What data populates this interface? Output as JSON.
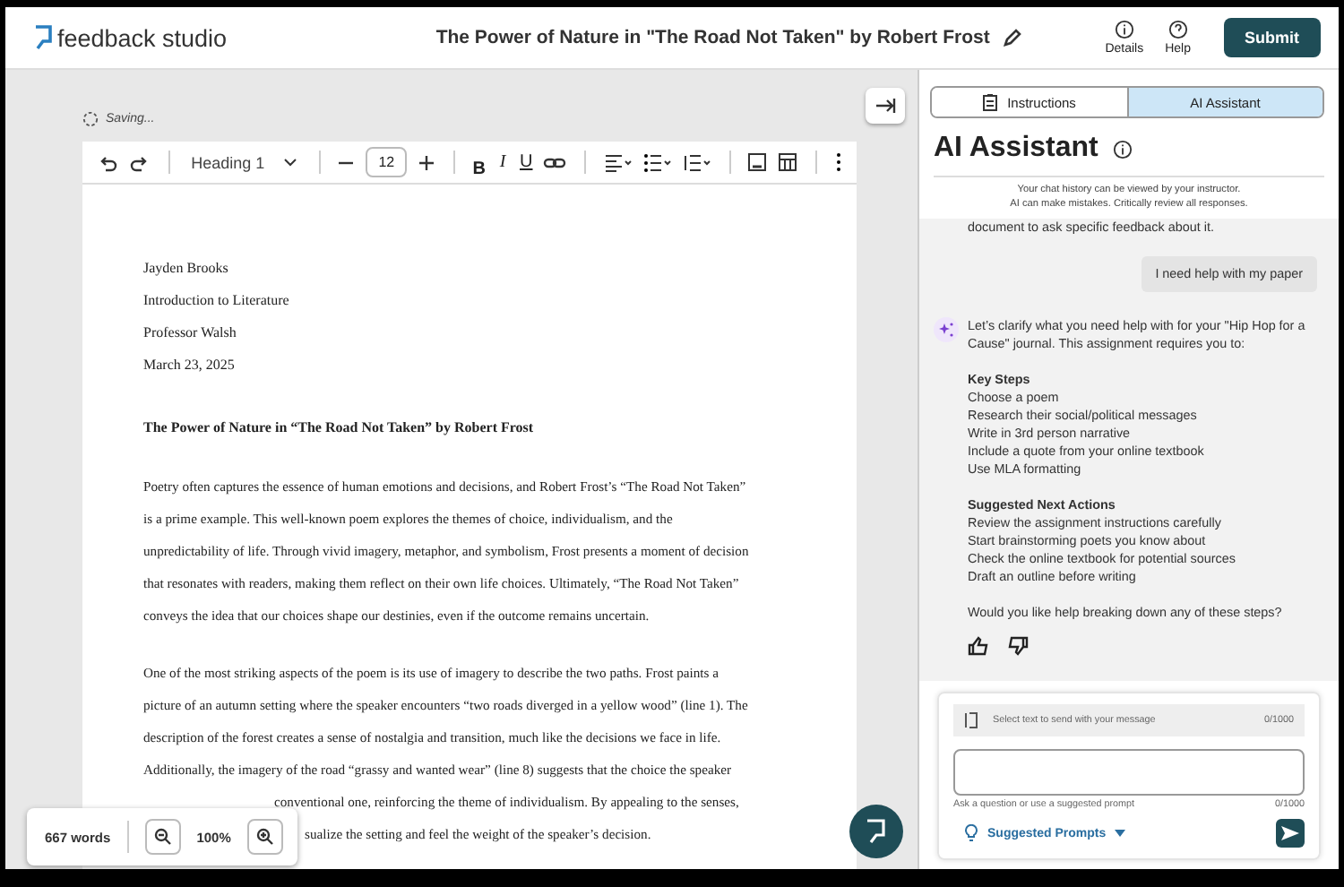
{
  "header": {
    "logo": "feedback studio",
    "title": "The Power of Nature in \"The Road Not Taken\" by Robert Frost",
    "actions": [
      {
        "kind": "details",
        "label": "Details"
      },
      {
        "kind": "help",
        "label": "Help"
      }
    ],
    "submit": "Submit"
  },
  "editor": {
    "status": "Saving...",
    "toolbar": {
      "style": "Heading 1",
      "font_size": "12",
      "format": [
        {
          "kind": "bold",
          "label": "B"
        },
        {
          "kind": "italic",
          "label": "I"
        },
        {
          "kind": "underline",
          "label": "U"
        }
      ]
    },
    "document": {
      "header_lines": [
        "Jayden Brooks",
        "Introduction to Literature",
        "Professor Walsh",
        "March 23, 2025"
      ],
      "title": "The Power of Nature in “The Road Not Taken” by Robert Frost",
      "paragraphs": [
        [
          "Poetry often captures the essence of human emotions and decisions, and Robert Frost’s “The Road Not Taken”",
          "is a prime example. This well-known poem explores the themes of choice, individualism, and the",
          "unpredictability of life. Through vivid imagery, metaphor, and symbolism, Frost presents a moment of decision",
          "that resonates with readers, making them reflect on their own life choices. Ultimately, “The Road Not Taken”",
          "conveys the idea that our choices shape our destinies, even if the outcome remains uncertain."
        ],
        [
          "One of the most striking aspects of the poem is its use of imagery to describe the two paths. Frost paints a",
          "picture of an autumn setting where the speaker encounters “two roads diverged in a yellow wood” (line 1). The",
          "description of the forest creates a sense of nostalgia and transition, much like the decisions we face in life.",
          "Additionally, the imagery of the road “grassy and wanted wear” (line 8) suggests that the choice the speaker",
          "conventional one, reinforcing the theme of individualism. By appealing to the senses,",
          "sualize the setting and feel the weight of the speaker’s decision."
        ]
      ]
    },
    "footer": {
      "word_count": "667 words",
      "zoom": "100%"
    }
  },
  "panel": {
    "tabs": [
      {
        "kind": "instructions",
        "label": "Instructions",
        "selected": false
      },
      {
        "kind": "assistant",
        "label": "AI Assistant",
        "selected": true
      }
    ],
    "heading": "AI Assistant",
    "notice": [
      "Your chat history can be viewed by your instructor.",
      "AI can make mistakes. Critically review all responses."
    ],
    "messages": [
      {
        "kind": "fragment",
        "text": "document to ask specific feedback about it."
      },
      {
        "kind": "user",
        "text": "I need help with my paper"
      },
      {
        "kind": "assistant",
        "intro": "Let’s clarify what you need help with for your \"Hip Hop for a Cause\" journal. This assignment requires you to:",
        "sections": [
          {
            "heading": "Key Steps",
            "items": [
              "Choose a poem",
              "Research their social/political messages",
              "Write in 3rd person narrative",
              "Include a quote from your online textbook",
              "Use MLA formatting"
            ]
          },
          {
            "heading": "Suggested Next Actions",
            "items": [
              "Review the assignment instructions carefully",
              "Start brainstorming poets you know about",
              "Check the online textbook for potential sources",
              "Draft an outline before writing"
            ]
          }
        ],
        "question": "Would you like help breaking down any of these steps?"
      }
    ],
    "composer": {
      "context_placeholder": "Select text to send with your message",
      "context_count": "0/1000",
      "hint": "Ask a question or use a suggested prompt",
      "count": "0/1000",
      "prompts": "Suggested Prompts"
    }
  }
}
